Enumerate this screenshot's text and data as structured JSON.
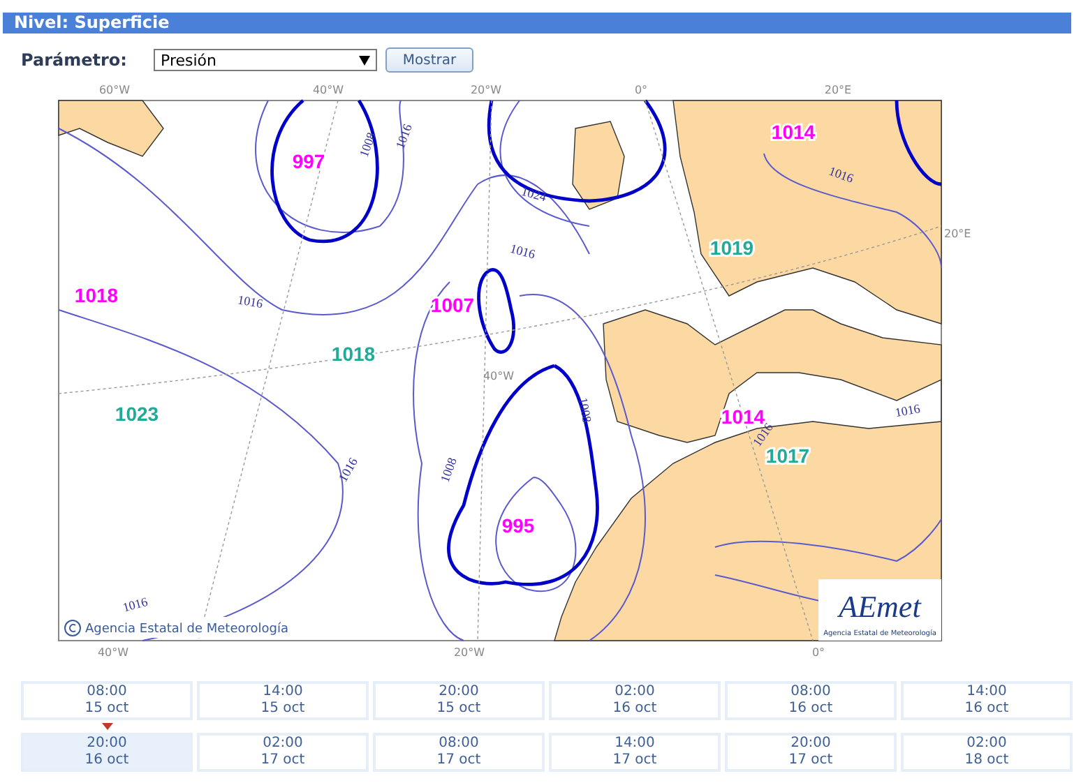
{
  "header": {
    "title": "Nivel: Superficie"
  },
  "controls": {
    "label": "Parámetro:",
    "select_value": "Presión",
    "button": "Mostrar"
  },
  "map": {
    "top_labels": [
      "60°W",
      "40°W",
      "20°W",
      "0°",
      "20°E"
    ],
    "right_labels": [
      "20°E"
    ],
    "bottom_labels": [
      "40°W",
      "20°W",
      "0°"
    ],
    "inner_labels": [
      "40°W"
    ],
    "pressure_centers": [
      {
        "value": "997",
        "color": "#ff00ff"
      },
      {
        "value": "1014",
        "color": "#ff00ff"
      },
      {
        "value": "1019",
        "color": "#22aa99"
      },
      {
        "value": "1018",
        "color": "#ff00ff"
      },
      {
        "value": "1007",
        "color": "#ff00ff"
      },
      {
        "value": "1018",
        "color": "#22aa99"
      },
      {
        "value": "1023",
        "color": "#22aa99"
      },
      {
        "value": "1014",
        "color": "#ff00ff"
      },
      {
        "value": "1017",
        "color": "#22aa99"
      },
      {
        "value": "995",
        "color": "#ff00ff"
      }
    ],
    "isobar_labels": [
      "1008",
      "1016",
      "1024",
      "1016",
      "1016",
      "1016",
      "1008",
      "1008",
      "1016",
      "1016",
      "1016",
      "1016"
    ],
    "copyright": "Agencia Estatal de Meteorología",
    "logo": {
      "mark": "AEmet",
      "caption": "Agencia Estatal de Meteorología"
    }
  },
  "times": [
    {
      "time": "08:00",
      "date": "15 oct",
      "selected": false
    },
    {
      "time": "14:00",
      "date": "15 oct",
      "selected": false
    },
    {
      "time": "20:00",
      "date": "15 oct",
      "selected": false
    },
    {
      "time": "02:00",
      "date": "16 oct",
      "selected": false
    },
    {
      "time": "08:00",
      "date": "16 oct",
      "selected": false
    },
    {
      "time": "14:00",
      "date": "16 oct",
      "selected": false
    },
    {
      "time": "20:00",
      "date": "16 oct",
      "selected": true
    },
    {
      "time": "02:00",
      "date": "17 oct",
      "selected": false
    },
    {
      "time": "08:00",
      "date": "17 oct",
      "selected": false
    },
    {
      "time": "14:00",
      "date": "17 oct",
      "selected": false
    },
    {
      "time": "20:00",
      "date": "17 oct",
      "selected": false
    },
    {
      "time": "02:00",
      "date": "18 oct",
      "selected": false
    }
  ]
}
